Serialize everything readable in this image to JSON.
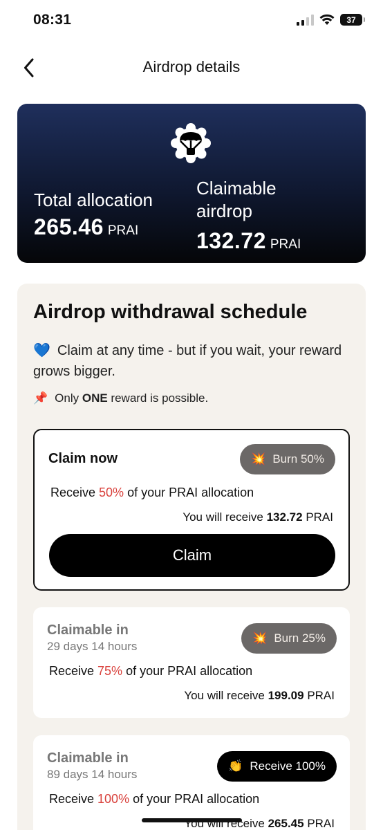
{
  "status_bar": {
    "time": "08:31",
    "battery": "37"
  },
  "nav": {
    "title": "Airdrop details"
  },
  "hero": {
    "total_label": "Total allocation",
    "total_value": "265.46",
    "total_unit": "PRAI",
    "claimable_label": "Claimable airdrop",
    "claimable_value": "132.72",
    "claimable_unit": "PRAI"
  },
  "schedule": {
    "title": "Airdrop withdrawal schedule",
    "note1_emoji": "💙",
    "note1_text": "Claim at any time - but if you wait, your reward grows bigger.",
    "note2_emoji": "📌",
    "note2_pre": "Only ",
    "note2_bold": "ONE",
    "note2_post": " reward is possible.",
    "tiers": [
      {
        "title": "Claim now",
        "badge_emoji": "💥",
        "badge_label": "Burn 50%",
        "receive_pre": "Receive ",
        "receive_pct": "50%",
        "receive_post": " of your PRAI allocation",
        "you_pre": "You will receive ",
        "you_value": "132.72",
        "you_unit": " PRAI",
        "button_label": "Claim"
      },
      {
        "title": "Claimable in",
        "subtitle": "29 days 14 hours",
        "badge_emoji": "💥",
        "badge_label": "Burn 25%",
        "receive_pre": "Receive ",
        "receive_pct": "75%",
        "receive_post": " of your PRAI allocation",
        "you_pre": "You will receive ",
        "you_value": "199.09",
        "you_unit": " PRAI"
      },
      {
        "title": "Claimable in",
        "subtitle": "89 days 14 hours",
        "badge_emoji": "👏",
        "badge_label": "Receive 100%",
        "receive_pre": "Receive ",
        "receive_pct": "100%",
        "receive_post": " of your PRAI allocation",
        "you_pre": "You will receive ",
        "you_value": "265.45",
        "you_unit": " PRAI"
      }
    ]
  }
}
